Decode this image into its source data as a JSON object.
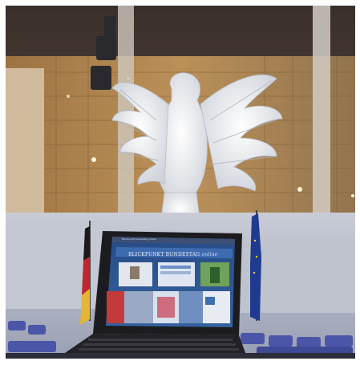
{
  "photo": {
    "laptop_screen": {
      "site_title": "BLICKPUNKT BUNDESTAG",
      "site_title_suffix": "online",
      "browser_caption": "Blickpunkt Bundestag online"
    },
    "colors": {
      "hall_amber": "#b98a4a",
      "eagle_white": "#e9ecf0",
      "plenary_blue": "#4b56a8",
      "screen_blue": "#2f5c9a",
      "flag_eu": "#1f3a8f"
    }
  }
}
